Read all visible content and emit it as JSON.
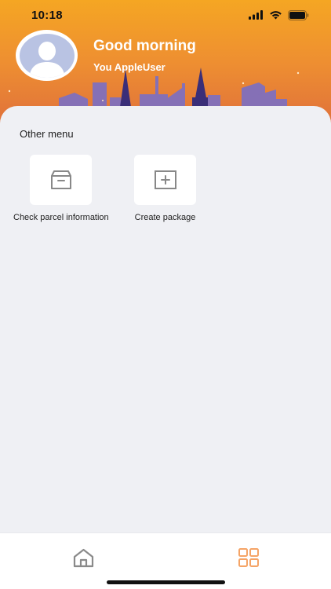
{
  "status_bar": {
    "time": "10:18",
    "icons": [
      "cellular-signal-icon",
      "wifi-icon",
      "battery-icon"
    ]
  },
  "header": {
    "greeting": "Good morning",
    "username": "You AppleUser",
    "avatar_icon": "user-avatar-icon",
    "gradient_colors": [
      "#f5a623",
      "#ee8f31",
      "#dd6b3d"
    ]
  },
  "other_menu": {
    "title": "Other menu",
    "items": [
      {
        "label": "Check parcel information",
        "icon": "parcel-box-icon"
      },
      {
        "label": "Create package",
        "icon": "add-package-icon"
      }
    ]
  },
  "tab_bar": {
    "tabs": [
      {
        "icon": "home-icon",
        "active": false
      },
      {
        "icon": "grid-menu-icon",
        "active": true
      }
    ],
    "active_color": "#f5a466",
    "inactive_color": "#8a8a8a"
  }
}
